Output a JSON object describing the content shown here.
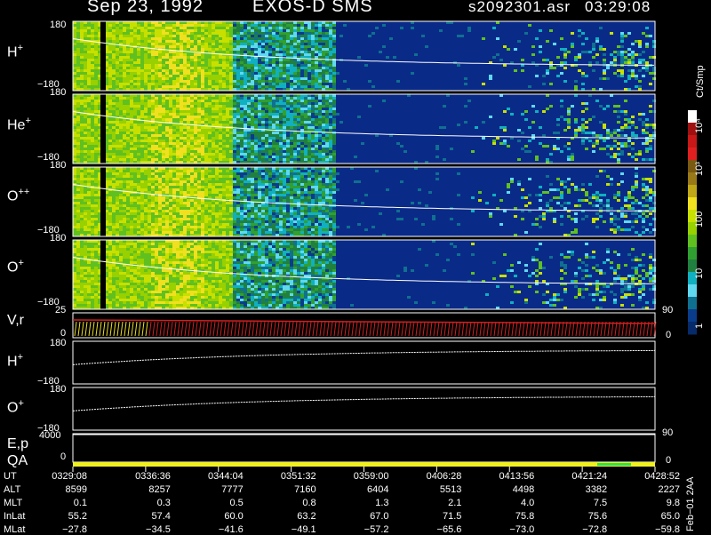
{
  "header": {
    "date": "Sep 23, 1992",
    "mission": "EXOS-D SMS",
    "file": "s2092301.asr",
    "time": "03:29:08"
  },
  "colorbar": {
    "units": "Ct/Smp",
    "labels": [
      "10⁴",
      "10³",
      "100",
      "10",
      "1"
    ],
    "colors": [
      "#ffffff",
      "#a01010",
      "#c81818",
      "#e02020",
      "#7a5a10",
      "#9a7a18",
      "#c0a818",
      "#f0e020",
      "#c8e000",
      "#98d000",
      "#60c020",
      "#30a030",
      "#208040",
      "#10b0c0",
      "#60d8f0",
      "#107090",
      "#0a3c8c",
      "#062a6a"
    ]
  },
  "colors": {
    "background": "#000000",
    "axis": "#ffffff",
    "velocity": "#d02020",
    "velocity_early": "#f0e020",
    "qa": "#f0f020",
    "qa_flag": "#30e050"
  },
  "panels": {
    "hplus": {
      "label": "H",
      "sup": "+",
      "ymax": "180",
      "ymin": "−180"
    },
    "heplus": {
      "label": "He",
      "sup": "+",
      "ymax": "180",
      "ymin": "−180"
    },
    "opp": {
      "label": "O",
      "sup": "++",
      "ymax": "180",
      "ymin": "−180"
    },
    "oplus": {
      "label": "O",
      "sup": "+",
      "ymax": "180",
      "ymin": "−180"
    },
    "vr": {
      "label": "V,r",
      "ymax": "25",
      "ymin": "0",
      "right_top": "90",
      "right_bot": "0"
    },
    "hplus2": {
      "label": "H",
      "sup": "+",
      "ymax": "180",
      "ymin": "−180"
    },
    "oplus2": {
      "label": "O",
      "sup": "+",
      "ymax": "180",
      "ymin": "−180"
    },
    "ep": {
      "label": "E,p",
      "ymax": "4000",
      "right": "90"
    },
    "qa": {
      "label": "QA",
      "ymin": "0",
      "right": "0"
    }
  },
  "chart_data": {
    "type": "heatmap",
    "title": "Sep 23, 1992  EXOS-D SMS",
    "x_ticks": [
      "0329:08",
      "0336:36",
      "0344:04",
      "0351:32",
      "0359:00",
      "0406:28",
      "0413:56",
      "0421:24",
      "0428:52"
    ],
    "y_range": [
      -180,
      180
    ],
    "colorbar_range": [
      1,
      10000
    ],
    "colorbar_scale": "log",
    "table": {
      "UT": [
        "0329:08",
        "0336:36",
        "0344:04",
        "0351:32",
        "0359:00",
        "0406:28",
        "0413:56",
        "0421:24",
        "0428:52"
      ],
      "ALT": [
        "8599",
        "8257",
        "7777",
        "7160",
        "6404",
        "5513",
        "4498",
        "3382",
        "2227"
      ],
      "MLT": [
        "0.1",
        "0.3",
        "0.5",
        "0.8",
        "1.3",
        "2.1",
        "4.0",
        "7.5",
        "9.8"
      ],
      "InLat": [
        "55.2",
        "57.4",
        "60.0",
        "63.2",
        "67.0",
        "71.5",
        "75.8",
        "75.6",
        "65.0"
      ],
      "MLat": [
        "−27.8",
        "−34.5",
        "−41.6",
        "−49.1",
        "−57.2",
        "−65.6",
        "−73.0",
        "−72.8",
        "−59.8"
      ]
    }
  },
  "footer_note": "Feb−01 2AA"
}
